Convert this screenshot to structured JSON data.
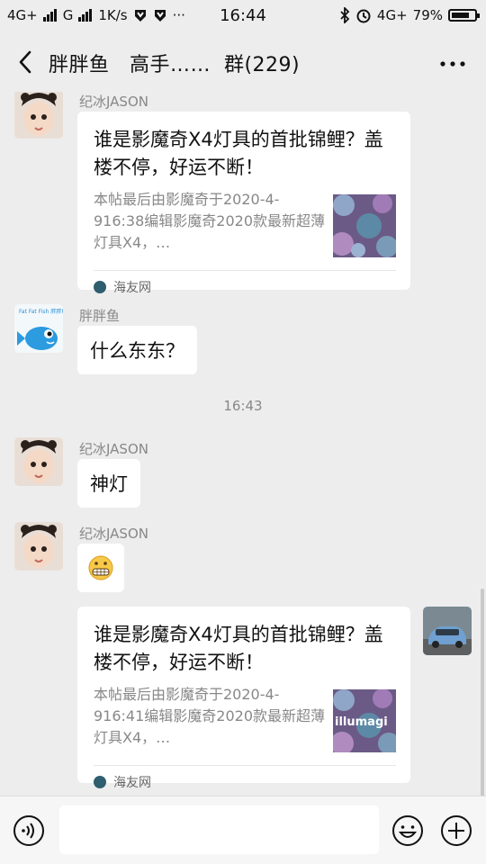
{
  "status_bar": {
    "left_net1": "4G+",
    "left_net2": "G",
    "speed": "1K/s",
    "dots": "···",
    "time": "16:44",
    "right_net": "4G+",
    "battery_pct": "79%",
    "battery_level": 0.79
  },
  "header": {
    "title": "胖胖鱼   高手……  群(229)",
    "back_icon": "chevron-left-icon",
    "more_icon": "more-icon"
  },
  "chat": {
    "messages": [
      {
        "sender": "纪冰JASON",
        "card_title": "谁是影魔奇X4灯具的首批锦鲤？盖楼不停，好运不断！",
        "card_desc": "本帖最后由影魔奇于2020-4-916:38编辑影魔奇2020款最新超薄灯具X4，…",
        "source": "海友网"
      },
      {
        "sender": "胖胖鱼",
        "text": "什么东东？",
        "avatar_text": "Fat Fat Fish 胖胖鱼"
      },
      {
        "timestamp": "16:43"
      },
      {
        "sender": "纪冰JASON",
        "text": "神灯"
      },
      {
        "sender": "纪冰JASON",
        "emoji": "😬"
      },
      {
        "self": true,
        "card_title": "谁是影魔奇X4灯具的首批锦鲤？盖楼不停，好运不断！",
        "card_desc": "本帖最后由影魔奇于2020-4-916:41编辑影魔奇2020款最新超薄灯具X4，…",
        "source": "海友网",
        "thumb_text": "illumagi"
      }
    ]
  },
  "input_bar": {
    "voice_icon": "voice-icon",
    "emoji_icon": "emoji-icon",
    "plus_icon": "plus-icon"
  }
}
